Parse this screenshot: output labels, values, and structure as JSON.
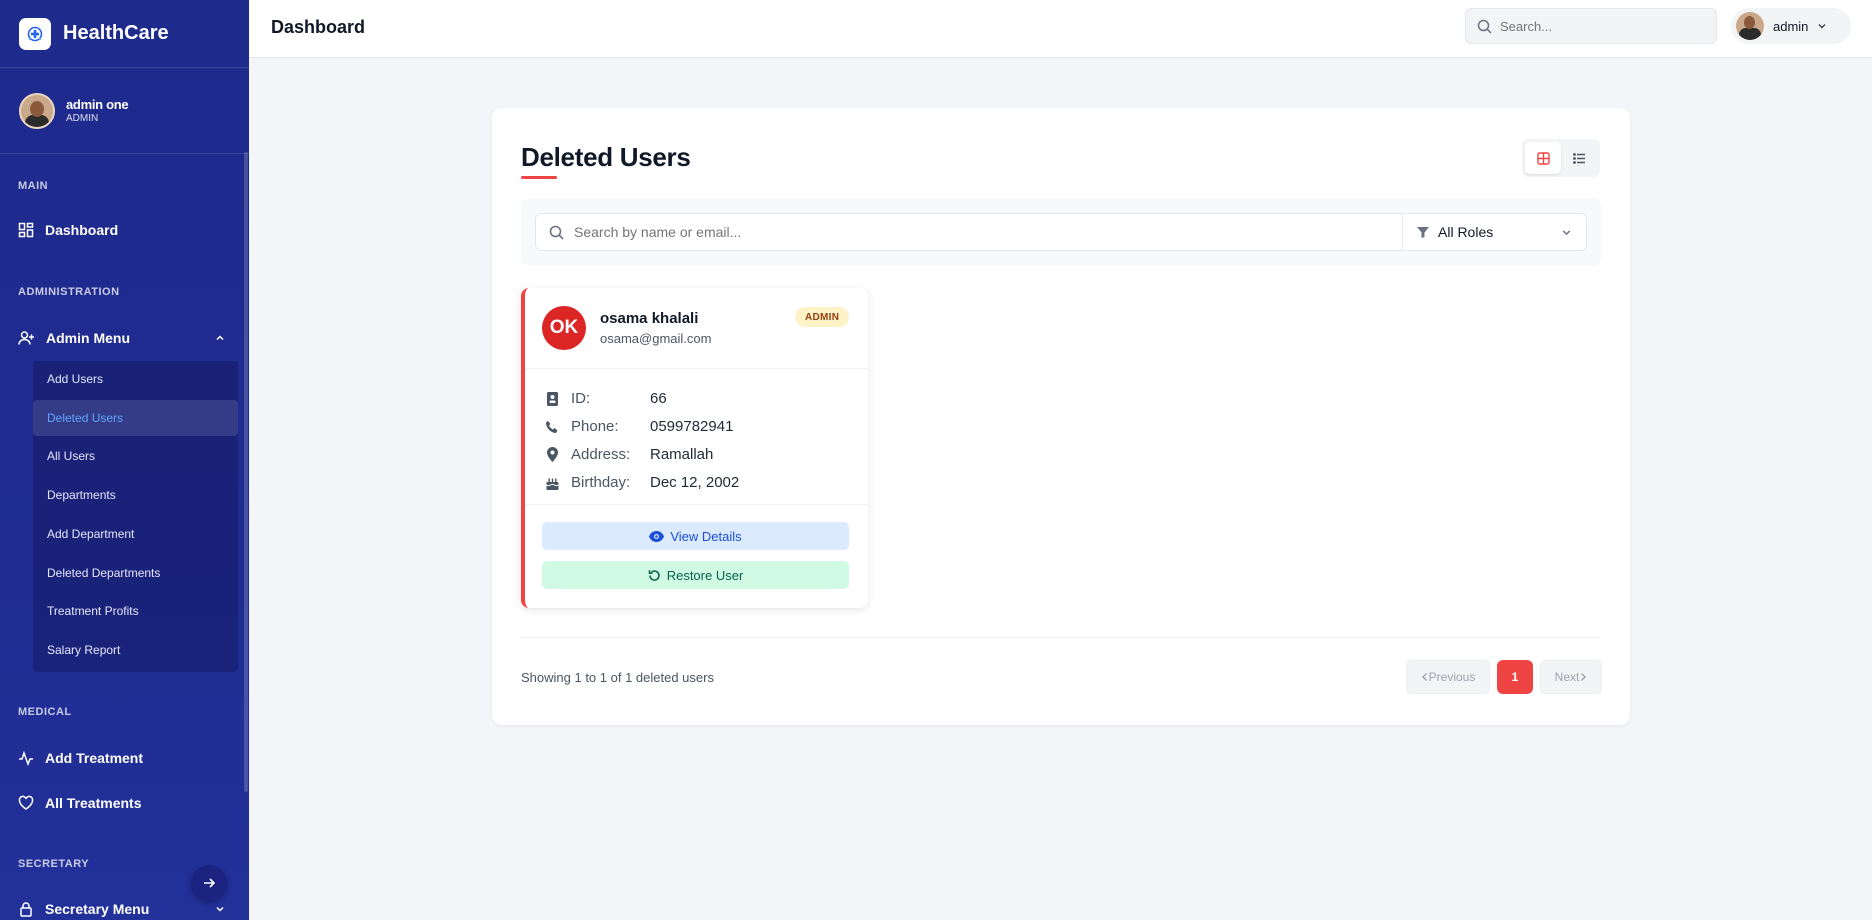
{
  "app": {
    "name": "HealthCare"
  },
  "profile": {
    "name": "admin one",
    "role": "ADMIN"
  },
  "sidebar": {
    "sections": {
      "main": "MAIN",
      "administration": "ADMINISTRATION",
      "medical": "MEDICAL",
      "secretary": "SECRETARY"
    },
    "dashboard": "Dashboard",
    "admin_menu": "Admin Menu",
    "admin_items": [
      "Add Users",
      "Deleted Users",
      "All Users",
      "Departments",
      "Add Department",
      "Deleted Departments",
      "Treatment Profits",
      "Salary Report"
    ],
    "active_item": "Deleted Users",
    "add_treatment": "Add Treatment",
    "all_treatments": "All Treatments",
    "secretary_menu": "Secretary Menu"
  },
  "header": {
    "title": "Dashboard",
    "search_placeholder": "Search...",
    "user_name": "admin"
  },
  "page": {
    "title": "Deleted Users",
    "search_placeholder": "Search by name or email...",
    "role_filter": "All Roles"
  },
  "user": {
    "initials": "OK",
    "name": "osama khalali",
    "email": "osama@gmail.com",
    "role_badge": "ADMIN",
    "fields": [
      {
        "label": "ID:",
        "value": "66",
        "icon": "id-card-icon"
      },
      {
        "label": "Phone:",
        "value": "0599782941",
        "icon": "phone-icon"
      },
      {
        "label": "Address:",
        "value": "Ramallah",
        "icon": "map-pin-icon"
      },
      {
        "label": "Birthday:",
        "value": "Dec 12, 2002",
        "icon": "cake-icon"
      }
    ],
    "view_label": "View Details",
    "restore_label": "Restore User"
  },
  "pagination": {
    "summary": "Showing 1 to 1 of 1 deleted users",
    "prev": "Previous",
    "current": "1",
    "next": "Next"
  },
  "colors": {
    "sidebar": "#1e2a8c",
    "accent": "#ef4444",
    "active_link": "#60a5fa"
  }
}
